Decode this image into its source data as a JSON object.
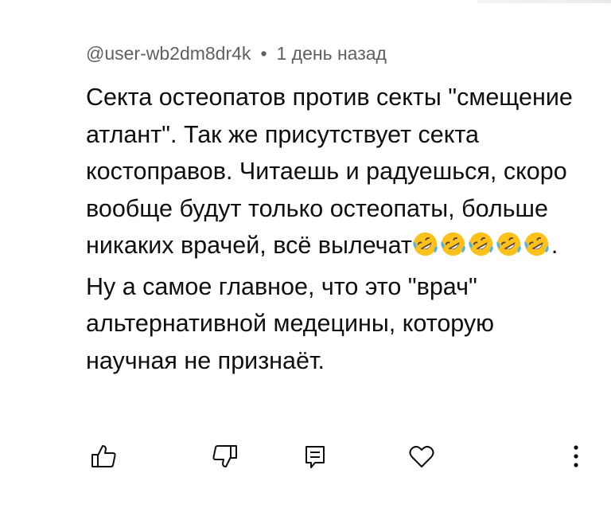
{
  "comment": {
    "author": "@user-wb2dm8dr4k",
    "separator": "•",
    "time": "1 день назад",
    "text_part1": "Секта остеопатов против секты \"смещение атлант\". Так же присутствует секта костоправов. Читаешь и радуешься, скоро вообще будут только остеопаты, больше никаких врачей, всё вылечат",
    "emojis": [
      "rolling-on-floor-laughing",
      "rolling-on-floor-laughing",
      "rolling-on-floor-laughing",
      "rolling-on-floor-laughing",
      "rolling-on-floor-laughing"
    ],
    "text_part2": ". Ну а самое главное, что это \"врач\" альтернативной медецины, которую научная не признаёт."
  },
  "actions": {
    "like_icon": "thumbs-up-icon",
    "dislike_icon": "thumbs-down-icon",
    "reply_icon": "reply-icon",
    "heart_icon": "heart-icon",
    "more_icon": "more-vertical-icon"
  },
  "colors": {
    "text": "#0f0f0f",
    "meta": "#606060",
    "emoji_face": "#fcc21b",
    "emoji_tears": "#4fb3e8"
  }
}
